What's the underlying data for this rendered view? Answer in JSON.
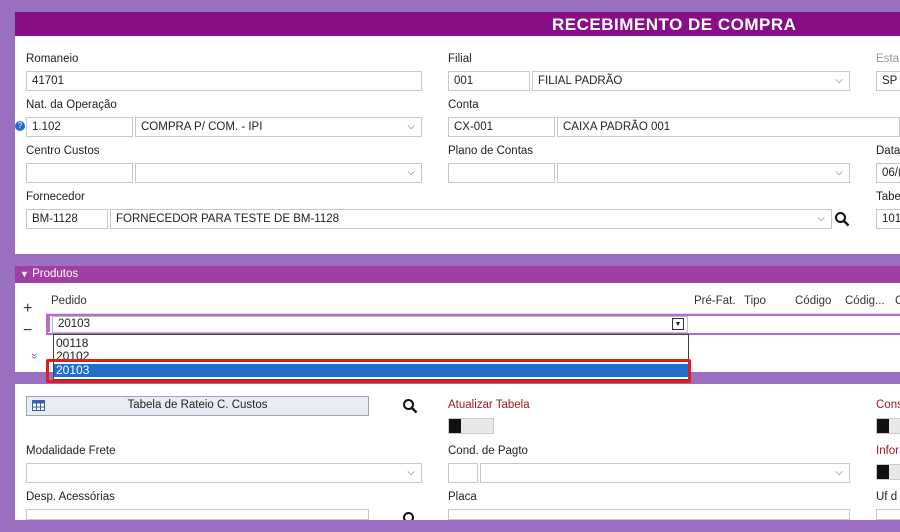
{
  "header": {
    "title": "RECEBIMENTO DE COMPRA"
  },
  "form": {
    "romaneio_label": "Romaneio",
    "romaneio_value": "41701",
    "filial_label": "Filial",
    "filial_code": "001",
    "filial_name": "FILIAL PADRÃO",
    "estado_label": "Esta",
    "estado_value": "SP",
    "nat_operacao_label": "Nat. da Operação",
    "nat_operacao_code": "1.102",
    "nat_operacao_name": "COMPRA P/ COM. - IPI",
    "conta_label": "Conta",
    "conta_code": "CX-001",
    "conta_name": "CAIXA PADRÃO 001",
    "centro_custos_label": "Centro Custos",
    "plano_contas_label": "Plano de Contas",
    "data_label": "Data",
    "data_value": "06/(",
    "fornecedor_label": "Fornecedor",
    "fornecedor_code": "BM-1128",
    "fornecedor_name": "FORNECEDOR PARA TESTE DE BM-1128",
    "tabela_label": "Tabe",
    "tabela_value": "101"
  },
  "produtos": {
    "section_label": "Produtos",
    "add_label": "+",
    "remove_label": "−",
    "expand_label": "»",
    "columns": {
      "pedido": "Pedido",
      "prefat": "Pré-Fat.",
      "tipo": "Tipo",
      "codigo": "Código",
      "codigo2": "Códig...",
      "extra": "C"
    },
    "pedido_value": "20103",
    "options": [
      "00118",
      "20102",
      "20103"
    ]
  },
  "footer": {
    "rateio_button": "Tabela de Rateio C. Custos",
    "atualizar_label": "Atualizar Tabela",
    "cons_label": "Cons",
    "modalidade_label": "Modalidade Frete",
    "cond_pagto_label": "Cond. de Pagto",
    "infor_label": "Infor",
    "desp_label": "Desp. Acessórias",
    "placa_label": "Placa",
    "uf_label": "Uf d"
  },
  "colors": {
    "title_bar": "#860f86",
    "section_bar": "#a13ea4",
    "selection": "#1f6fd1",
    "highlight": "#e31b1b"
  }
}
